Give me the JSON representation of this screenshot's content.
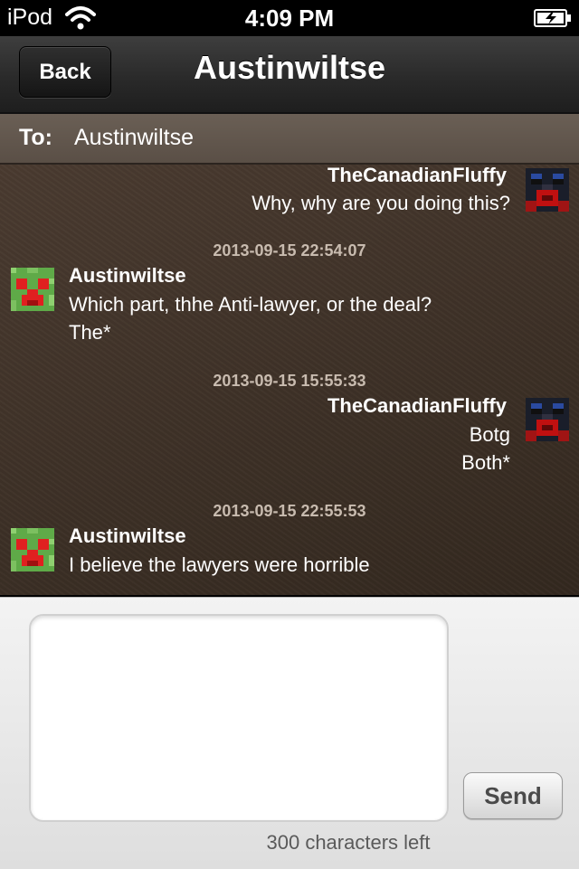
{
  "status_bar": {
    "carrier": "iPod",
    "time": "4:09 PM",
    "wifi_icon": "wifi-icon",
    "battery_icon": "battery-charging-icon"
  },
  "nav": {
    "back_label": "Back",
    "title": "Austinwiltse"
  },
  "to_bar": {
    "label": "To:",
    "value": "Austinwiltse"
  },
  "messages": [
    {
      "sender": "TheCanadianFluffy",
      "side": "right",
      "lines": [
        "Why, why are you doing this?"
      ]
    },
    {
      "timestamp": "2013-09-15 22:54:07",
      "sender": "Austinwiltse",
      "side": "left",
      "lines": [
        "Which part, thhe Anti-lawyer, or the deal?",
        "The*"
      ]
    },
    {
      "timestamp": "2013-09-15 15:55:33",
      "sender": "TheCanadianFluffy",
      "side": "right",
      "lines": [
        "Botg",
        "Both*"
      ]
    },
    {
      "timestamp": "2013-09-15 22:55:53",
      "sender": "Austinwiltse",
      "side": "left",
      "lines": [
        "I believe the lawyers were horrible"
      ]
    }
  ],
  "composer": {
    "input_value": "",
    "send_label": "Send",
    "chars_left": "300 characters left"
  },
  "colors": {
    "chat_background": "#3d3128",
    "timestamp": "#c8bbaf",
    "nav_bar": "#2a2a2a",
    "creeper_green": "#5faa48",
    "creeper_red": "#e02020",
    "dark_avatar": "#1a2030"
  }
}
